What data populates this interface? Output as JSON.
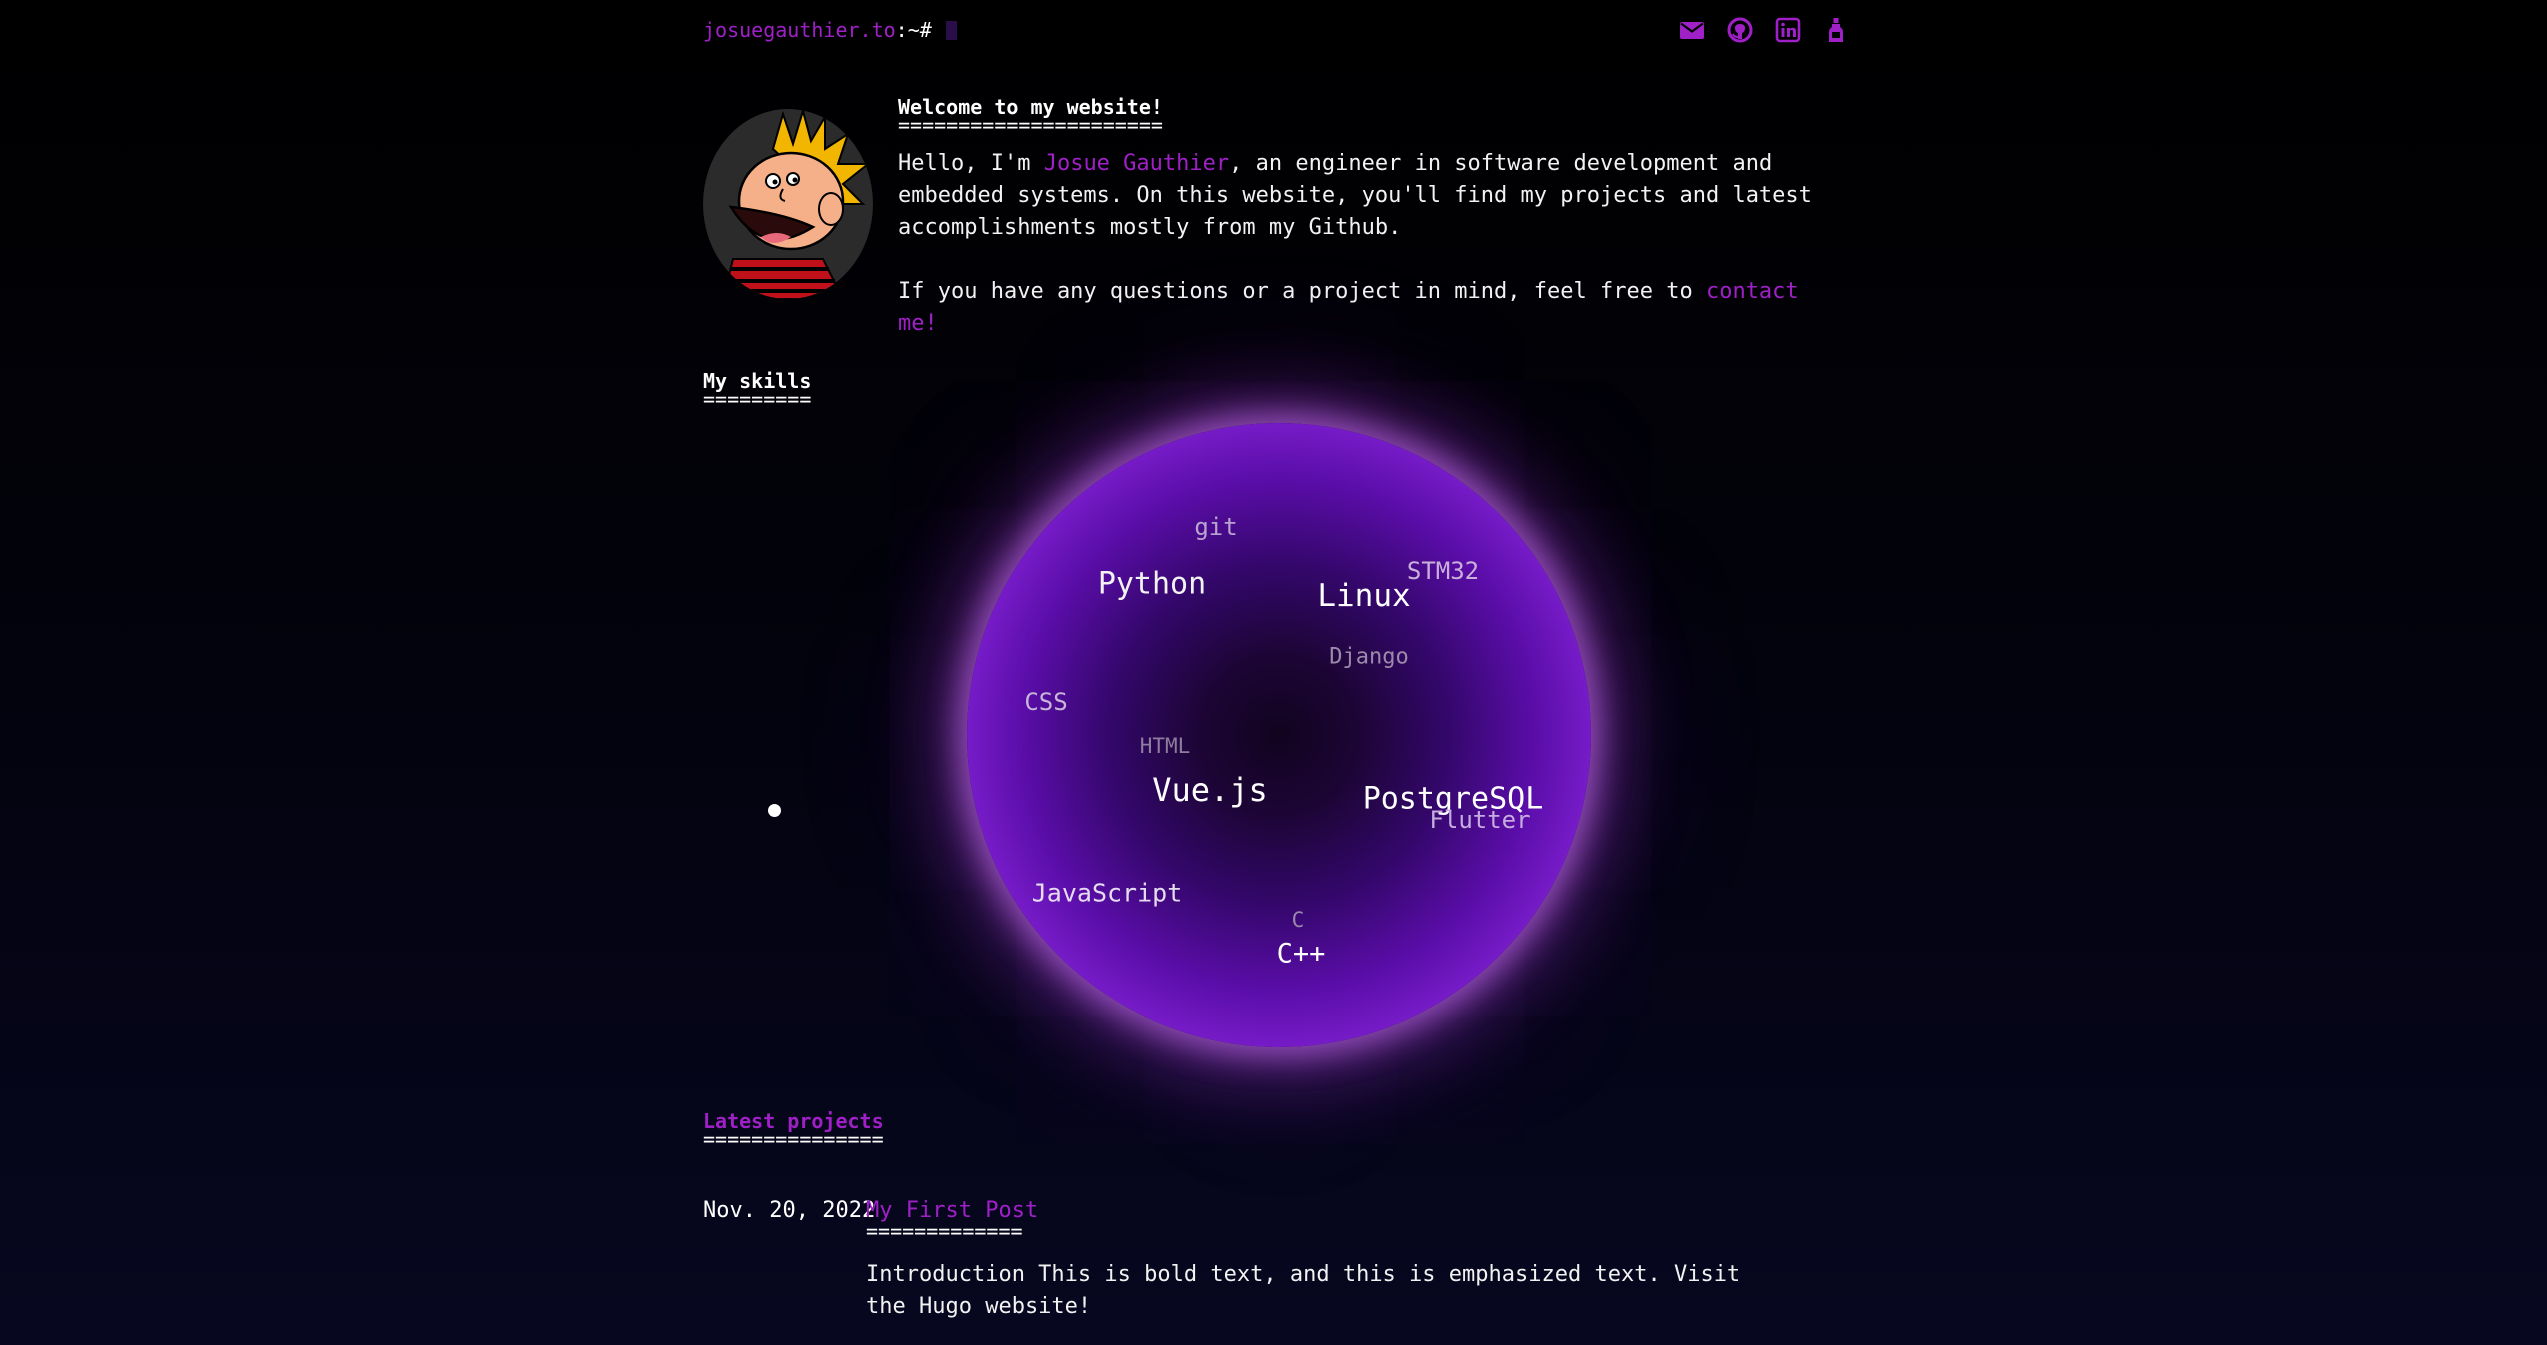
{
  "header": {
    "host": "josuegauthier.to",
    "path": ":~#",
    "social": [
      {
        "icon": "email-icon"
      },
      {
        "icon": "github-icon"
      },
      {
        "icon": "linkedin-icon"
      },
      {
        "icon": "bottle-icon"
      }
    ]
  },
  "intro": {
    "avatar_icon": "avatar-icon",
    "title": "Welcome to my website!",
    "title_underline": "======================",
    "p1_before": "Hello, I'm ",
    "name": "Josue Gauthier",
    "p1_after": ", an engineer in software development and embedded systems. On this website, you'll find my projects and latest accomplishments mostly from my Github.",
    "p2_before": "If you have any questions or a project in mind, feel free to ",
    "contact_link": "contact me!"
  },
  "skills": {
    "title": "My skills",
    "title_underline": "=========",
    "items": [
      {
        "label": "git",
        "size": 24,
        "color": "#b9a4cf"
      },
      {
        "label": "Python",
        "size": 30,
        "color": "#f2f2f2"
      },
      {
        "label": "Linux",
        "size": 31,
        "color": "#ffffff"
      },
      {
        "label": "STM32",
        "size": 24,
        "color": "#c9b0db"
      },
      {
        "label": "Django",
        "size": 22,
        "color": "#9c8aab"
      },
      {
        "label": "CSS",
        "size": 24,
        "color": "#c8b5d9"
      },
      {
        "label": "HTML",
        "size": 21,
        "color": "#8d7d9e"
      },
      {
        "label": "Vue.js",
        "size": 32,
        "color": "#ffffff"
      },
      {
        "label": "PostgreSQL",
        "size": 30,
        "color": "#ffffff"
      },
      {
        "label": "Flutter",
        "size": 24,
        "color": "#c6abe0"
      },
      {
        "label": "JavaScript",
        "size": 25,
        "color": "#e6dcef"
      },
      {
        "label": "C",
        "size": 21,
        "color": "#9a88ab"
      },
      {
        "label": "C++",
        "size": 27,
        "color": "#ffffff"
      }
    ]
  },
  "projects": {
    "title": "Latest projects",
    "title_underline": "===============",
    "posts": [
      {
        "date": "Nov. 20, 2022",
        "title": "My First Post",
        "title_underline": "=============",
        "summary": "Introduction This is bold text, and this is emphasized text. Visit the Hugo website!"
      }
    ]
  },
  "colors": {
    "accent": "#a020c8",
    "text": "#f2f2f2",
    "background": "#000000"
  }
}
